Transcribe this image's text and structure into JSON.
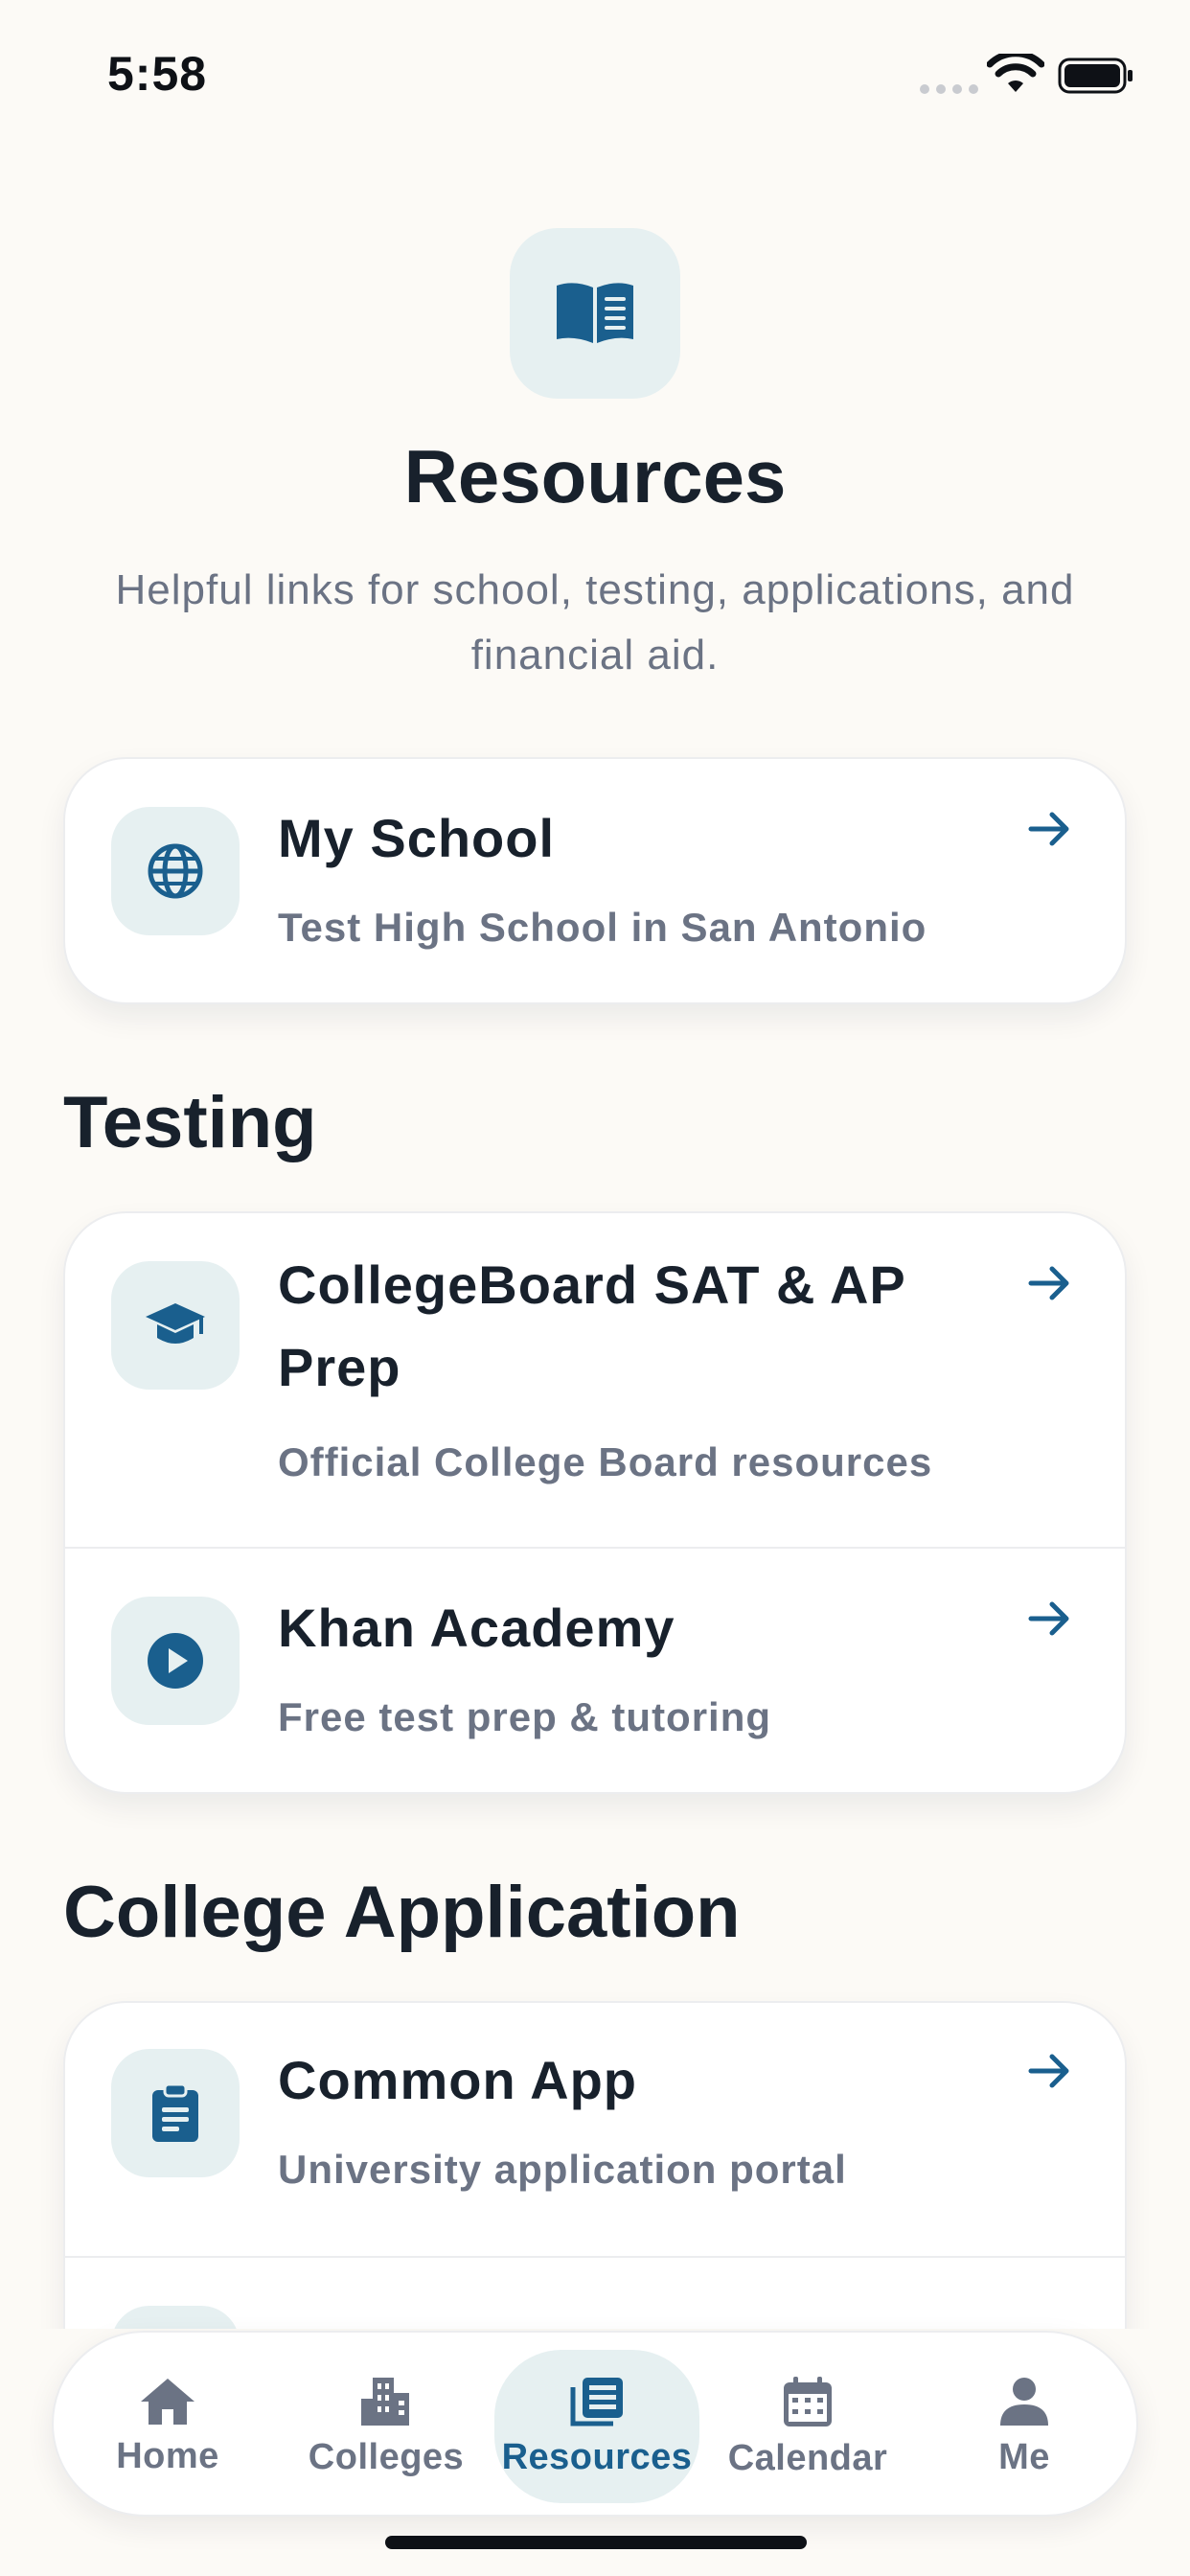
{
  "status_bar": {
    "time": "5:58"
  },
  "header": {
    "icon": "book-open-icon",
    "title": "Resources",
    "subtitle": "Helpful links for school, testing, applications, and financial aid."
  },
  "my_school": {
    "icon": "globe-icon",
    "title": "My School",
    "description": "Test High School in San Antonio"
  },
  "testing": {
    "heading": "Testing",
    "items": [
      {
        "icon": "graduation-cap-icon",
        "title": "CollegeBoard SAT & AP Prep",
        "description": "Official College Board resources"
      },
      {
        "icon": "play-circle-icon",
        "title": "Khan Academy",
        "description": "Free test prep & tutoring"
      }
    ]
  },
  "college_application": {
    "heading": "College Application",
    "items": [
      {
        "icon": "clipboard-icon",
        "title": "Common App",
        "description": "University application portal"
      }
    ]
  },
  "tabbar": {
    "tabs": [
      {
        "label": "Home",
        "icon": "home-icon"
      },
      {
        "label": "Colleges",
        "icon": "building-icon"
      },
      {
        "label": "Resources",
        "icon": "newspaper-icon",
        "active": true
      },
      {
        "label": "Calendar",
        "icon": "calendar-icon"
      },
      {
        "label": "Me",
        "icon": "person-icon"
      }
    ]
  },
  "colors": {
    "accent": "#1A5F8E",
    "icon_bg": "#E6F0F1",
    "background": "#FCFAF6",
    "muted_text": "#6B7384"
  }
}
